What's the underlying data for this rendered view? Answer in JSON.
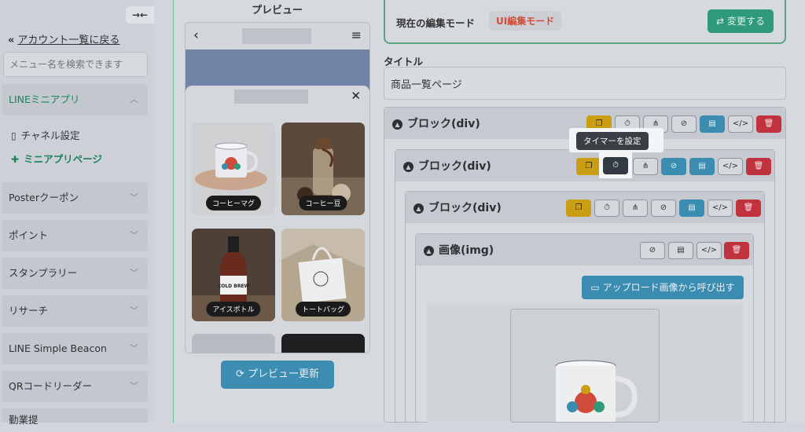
{
  "sidebar": {
    "collapse_icon": "→←",
    "back_link": "アカウント一覧に戻る",
    "search_placeholder": "メニュー名を検索できます",
    "sections": [
      {
        "label": "LINEミニアプリ",
        "active": true
      },
      {
        "label": "Posterクーポン"
      },
      {
        "label": "ポイント"
      },
      {
        "label": "スタンプラリー"
      },
      {
        "label": "リサーチ"
      },
      {
        "label": "LINE Simple Beacon"
      },
      {
        "label": "QRコードリーダー"
      },
      {
        "label": "勤業提"
      }
    ],
    "sub_items": [
      {
        "label": "チャネル設定",
        "icon": "phone-icon"
      },
      {
        "label": "ミニアプリページ",
        "icon": "puzzle-icon",
        "current": true
      }
    ]
  },
  "preview": {
    "title": "プレビュー",
    "products": [
      {
        "label": "コーヒーマグ"
      },
      {
        "label": "コーヒー豆"
      },
      {
        "label": "アイスボトル",
        "bottle_text": "COLD BREW"
      },
      {
        "label": "トートバッグ"
      }
    ],
    "refresh_label": "プレビュー更新"
  },
  "editor": {
    "mode_label": "現在の編集モード",
    "mode_value": "UI編集モード",
    "change_label": "変更する",
    "title_label": "タイトル",
    "title_value": "商品一覧ページ",
    "blocks": [
      {
        "title": "ブロック(div)"
      },
      {
        "title": "ブロック(div)"
      },
      {
        "title": "ブロック(div)"
      },
      {
        "title": "画像(img)"
      }
    ],
    "tooltip": "タイマーを設定",
    "upload_label": "アップロード画像から呼び出す"
  },
  "colors": {
    "accent_green": "#2f9a79",
    "active_green": "#17845c",
    "mode_red": "#d04b3a",
    "button_blue": "#3a8cb0",
    "button_yellow": "#c99e13",
    "button_red": "#c0323e"
  }
}
